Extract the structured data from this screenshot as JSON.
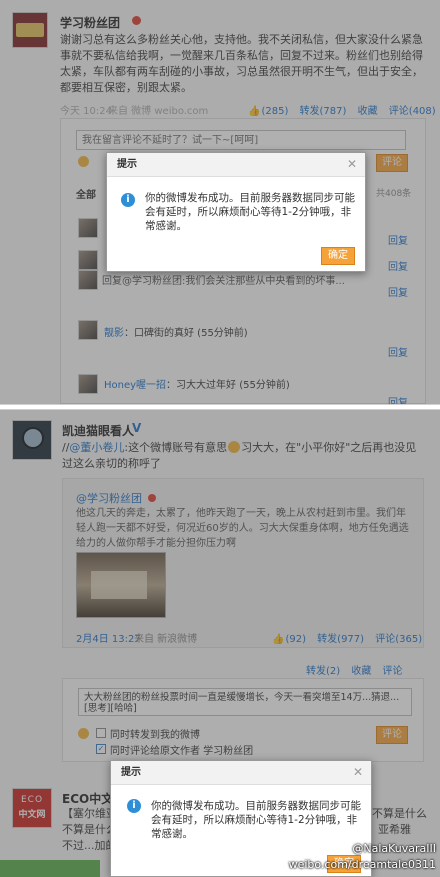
{
  "panel1": {
    "post": {
      "author": "学习粉丝团",
      "text": "谢谢习总有这么多粉丝关心他，支持他。我不关闭私信，但大家没什么紧急事就不要私信给我啊，一觉醒来几百条私信，回复不过来。粉丝们也别给得太紧，车队都有两车刮碰的小事故，习总虽然很开明不生气，但出于安全，都要相互保密，别跟太紧。",
      "time": "今天 10:24",
      "source": "来自 微博 weibo.com",
      "likes": "(285)",
      "repost": "转发(787)",
      "fav": "收藏",
      "comment": "评论(408)"
    },
    "comment_box": {
      "placeholder": "我在留言评论不延时了？试一下~[呵呵]",
      "submit": "评论"
    },
    "filter_all": "全部",
    "count_right": "共408条",
    "replies": [
      {
        "user": "",
        "text": "",
        "reply": "回复"
      },
      {
        "user": "",
        "text": "",
        "reply": "回复"
      },
      {
        "user": "",
        "text": "回复@学习粉丝团:我们会关注那些从中央看到的坏事...",
        "reply": "回复"
      },
      {
        "user": "靓影",
        "text": "：口碑街的真好 (55分钟前)",
        "reply": "回复"
      },
      {
        "user": "Honey喔一招",
        "text": "：习大大过年好 (55分钟前)",
        "reply": "回复"
      }
    ],
    "dialog": {
      "title": "提示",
      "message": "你的微博发布成功。目前服务器数据同步可能会有延时，所以麻烦耐心等待1-2分钟哦，非常感谢。",
      "confirm": "确定"
    }
  },
  "panel2": {
    "post": {
      "author": "凯迪猫眼看人",
      "verified": "V",
      "text_prefix": "//",
      "mention": "@董小卷儿",
      "text": ":这个微博账号有意思",
      "text2": "习大大，在\"小平你好\"之后再也没见过这么亲切的称呼了"
    },
    "quote": {
      "author": "@学习粉丝团",
      "text": "他这几天的奔走，太累了，他昨天跑了一天，晚上从农村赶到市里。我们年轻人跑一天都不好受，何况近60岁的人。习大大保重身体啊，地方任免遇选给力的人做你帮手才能分担你压力啊",
      "time": "2月4日 13:27",
      "source": "来自 新浪微博",
      "likes": "(92)",
      "repost": "转发(977)",
      "comment": "评论(365)"
    },
    "acts": {
      "repost": "转发(2)",
      "fav": "收藏",
      "comment": "评论"
    },
    "comment_box": {
      "value": "大大粉丝团的粉丝投票时间一直是缓慢增长，今天一看突增至14万...猜退...[思考][哈哈]",
      "submit": "评论",
      "check1": "同时转发到我的微博",
      "check2": "同时评论给原文作者 学习粉丝团"
    },
    "eco": {
      "logo_top": "ECO",
      "logo_bottom": "中文网",
      "name": "ECO中文网",
      "text": "【塞尔维亚...】...不算是什么新闻。不过...加的会见...",
      "right1": "不算是什么",
      "right2": "亚希雅"
    },
    "dialog": {
      "title": "提示",
      "message": "你的微博发布成功。目前服务器数据同步可能会有延时，所以麻烦耐心等待1-2分钟哦，非常感谢。",
      "confirm": "确定"
    },
    "watermark1": "@NalaKuvaraIII",
    "watermark2": "weibo.com/dreamtale0311"
  }
}
